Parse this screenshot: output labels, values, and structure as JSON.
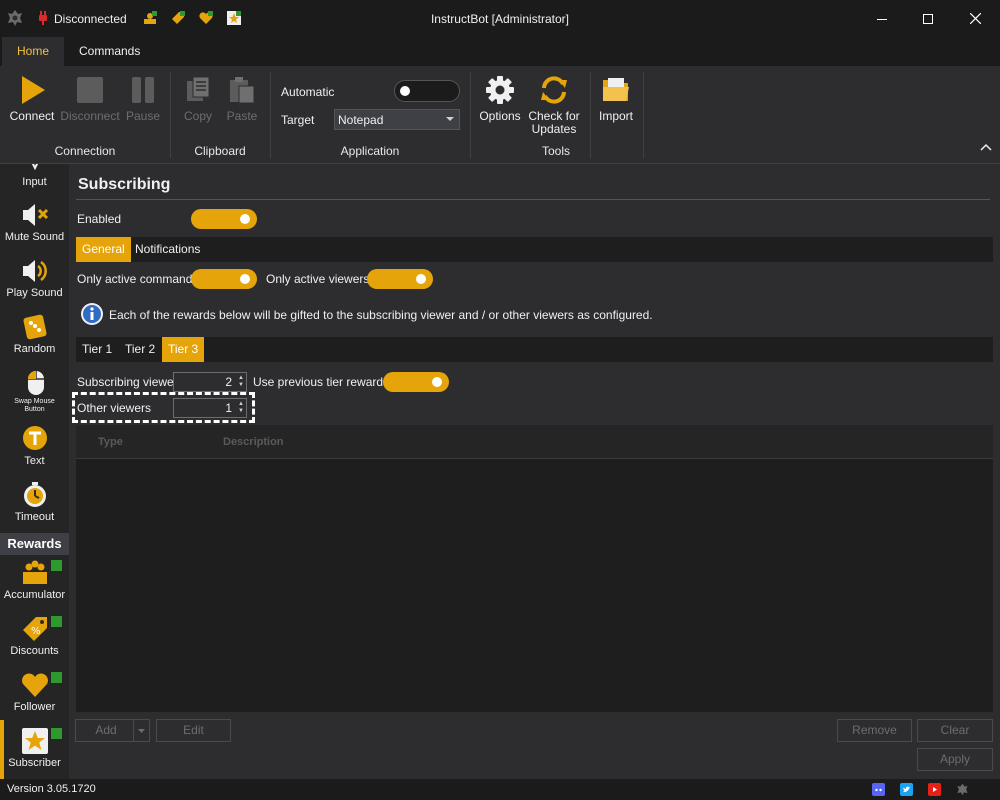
{
  "titlebar": {
    "status": "Disconnected",
    "title": "InstructBot [Administrator]"
  },
  "ribbon_tabs": [
    "Home",
    "Commands"
  ],
  "ribbon": {
    "connection": {
      "connect": "Connect",
      "disconnect": "Disconnect",
      "pause": "Pause",
      "group": "Connection"
    },
    "clipboard": {
      "copy": "Copy",
      "paste": "Paste",
      "group": "Clipboard"
    },
    "application": {
      "automatic_label": "Automatic",
      "automatic_on": false,
      "target_label": "Target",
      "target_value": "Notepad",
      "group": "Application"
    },
    "tools": {
      "options": "Options",
      "check_updates_1": "Check for",
      "check_updates_2": "Updates",
      "group": "Tools"
    },
    "import": "Import"
  },
  "sidebar": {
    "items": [
      {
        "label": "Input",
        "icon": "input-icon"
      },
      {
        "label": "Mute Sound",
        "icon": "mute-sound-icon"
      },
      {
        "label": "Play Sound",
        "icon": "play-sound-icon"
      },
      {
        "label": "Random",
        "icon": "dice-icon"
      },
      {
        "label_1": "Swap Mouse",
        "label_2": "Button",
        "icon": "mouse-icon"
      },
      {
        "label": "Text",
        "icon": "text-icon"
      },
      {
        "label": "Timeout",
        "icon": "stopwatch-icon"
      }
    ],
    "section": "Rewards",
    "rewards": [
      {
        "label": "Accumulator",
        "icon": "accumulator-icon"
      },
      {
        "label": "Discounts",
        "icon": "discount-tag-icon"
      },
      {
        "label": "Follower",
        "icon": "heart-icon"
      },
      {
        "label": "Subscriber",
        "icon": "star-icon"
      }
    ]
  },
  "main": {
    "title": "Subscribing",
    "enabled_label": "Enabled",
    "tabs": [
      "General",
      "Notifications"
    ],
    "only_active_commands": "Only active commands",
    "only_active_viewers": "Only active viewers",
    "info": "Each of the rewards below will be gifted to the subscribing viewer and / or other viewers as configured.",
    "tier_tabs": [
      "Tier 1",
      "Tier 2",
      "Tier 3"
    ],
    "subscribing_viewer_label": "Subscribing viewer",
    "subscribing_viewer_value": "2",
    "use_previous_label": "Use previous tier rewards",
    "other_viewers_label": "Other viewers",
    "other_viewers_value": "1",
    "grid_columns": [
      "Type",
      "Description"
    ],
    "buttons": {
      "add": "Add",
      "edit": "Edit",
      "remove": "Remove",
      "clear": "Clear",
      "apply": "Apply"
    }
  },
  "statusbar": {
    "version": "Version 3.05.1720"
  },
  "colors": {
    "accent": "#e5a50a",
    "background": "#2d2d30",
    "titlebar": "#1b1b1c"
  }
}
